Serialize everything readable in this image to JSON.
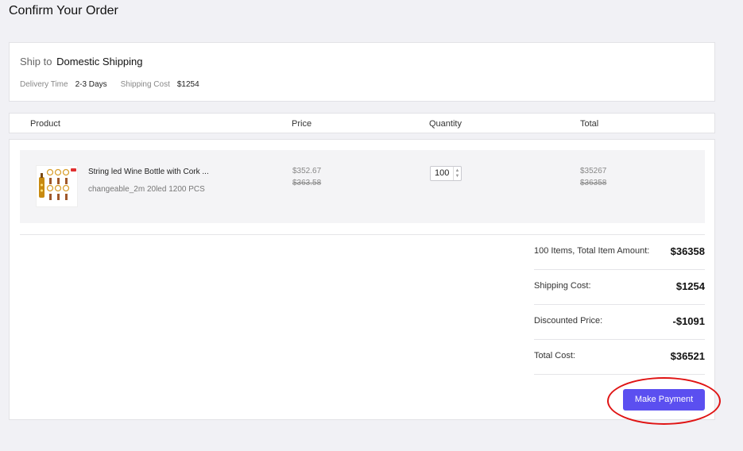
{
  "page": {
    "title": "Confirm Your Order"
  },
  "shipping": {
    "ship_to_label": "Ship to",
    "method": "Domestic Shipping",
    "delivery_time_label": "Delivery Time",
    "delivery_time_value": "2-3 Days",
    "cost_label": "Shipping Cost",
    "cost_value": "$1254"
  },
  "columns": [
    "Product",
    "Price",
    "Quantity",
    "Total"
  ],
  "item": {
    "name": "String led Wine Bottle with Cork ...",
    "variant": "changeable_2m 20led 1200 PCS",
    "price_now": "$352.67",
    "price_old": "$363.58",
    "quantity": "100",
    "total_now": "$35267",
    "total_old": "$36358",
    "thumbnail_icon": "product-thumbnail-icon"
  },
  "summary": [
    {
      "label": "100 Items, Total Item Amount:",
      "value": "$36358"
    },
    {
      "label": "Shipping Cost:",
      "value": "$1254"
    },
    {
      "label": "Discounted Price:",
      "value": "-$1091"
    },
    {
      "label": "Total Cost:",
      "value": "$36521"
    }
  ],
  "actions": {
    "pay_label": "Make Payment"
  },
  "colors": {
    "accent": "#5b4ff0",
    "highlight": "#e01414",
    "background": "#f1f1f5"
  }
}
